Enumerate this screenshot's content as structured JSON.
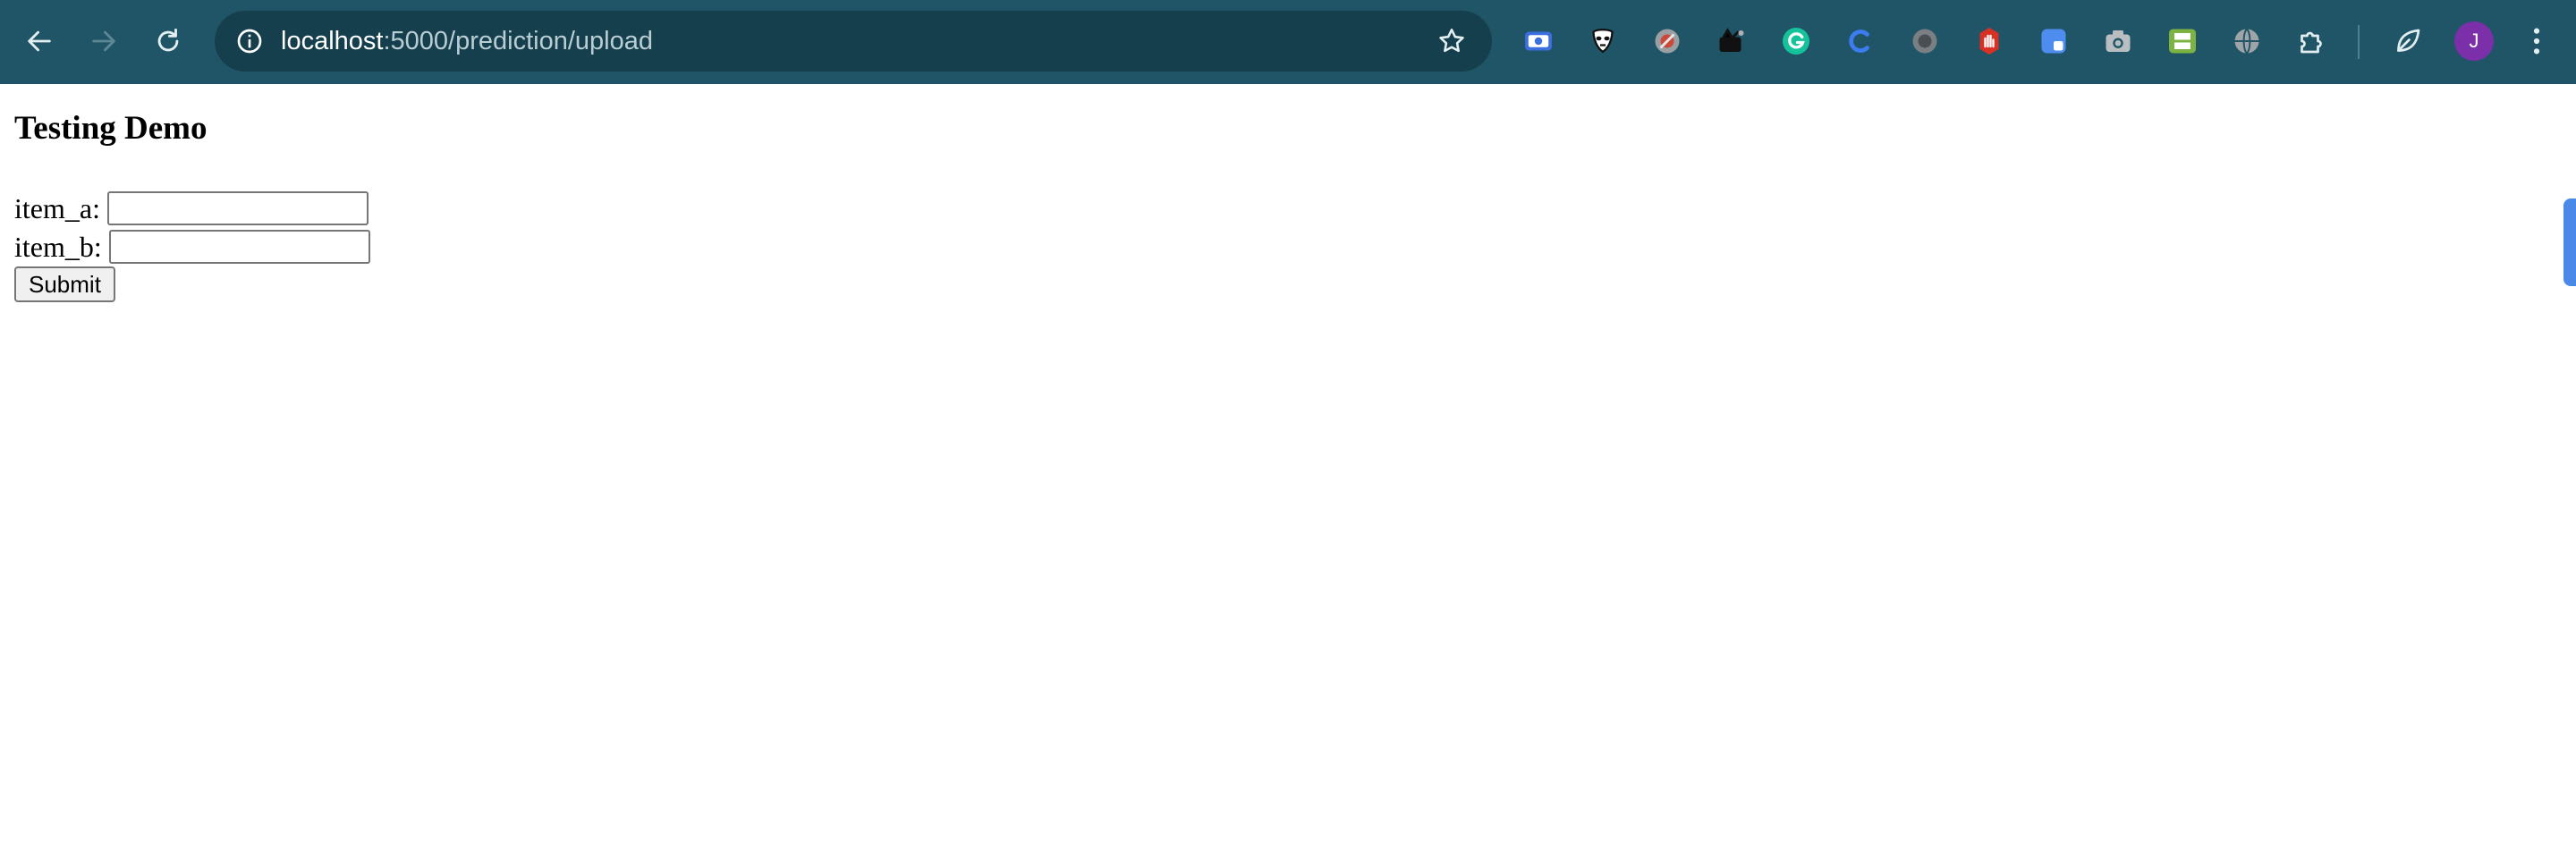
{
  "browser": {
    "url_host": "localhost",
    "url_path": ":5000/prediction/upload",
    "profile_initial": "J",
    "icons": {
      "back": "back-arrow-icon",
      "forward": "forward-arrow-icon",
      "reload": "reload-icon",
      "site_info": "site-info-icon",
      "bookmark": "bookmark-star-icon",
      "menu": "more-vert-icon"
    },
    "extensions": [
      "screen-capture-extension-icon",
      "mask-extension-icon",
      "round-badge-extension-icon",
      "dark-tools-extension-icon",
      "grammarly-extension-icon",
      "c-letter-extension-icon",
      "circle-extension-icon",
      "stop-hand-extension-icon",
      "square-tiles-extension-icon",
      "camera-extension-icon",
      "printer-extension-icon",
      "globe-extension-icon",
      "puzzle-extensions-icon",
      "leaf-extension-icon"
    ],
    "colors": {
      "toolbar": "#1f5566",
      "omnibox": "#163f4d",
      "avatar": "#7b2fa8"
    }
  },
  "page": {
    "title": "Testing Demo",
    "form": {
      "item_a_label": "item_a:",
      "item_a_value": "",
      "item_b_label": "item_b:",
      "item_b_value": "",
      "submit_label": "Submit"
    }
  }
}
